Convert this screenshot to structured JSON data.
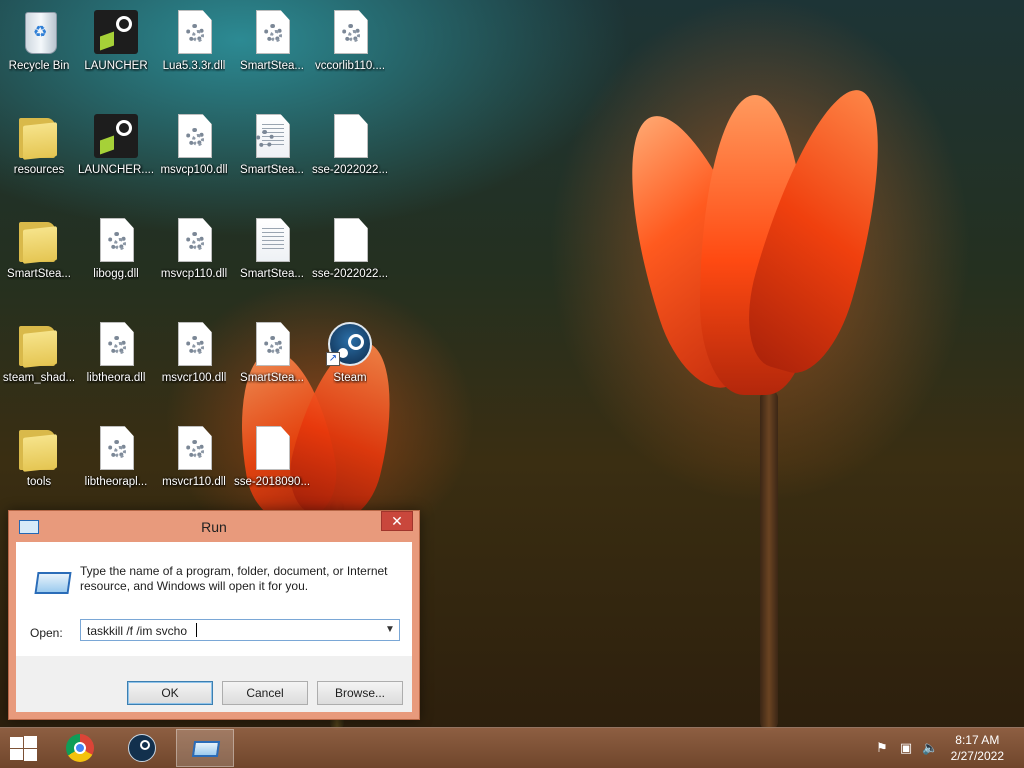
{
  "desktop": {
    "icons": [
      {
        "label": "Recycle Bin",
        "icon": "recycle-bin-icon"
      },
      {
        "label": "LAUNCHER",
        "icon": "launcher-app-icon"
      },
      {
        "label": "Lua5.3.3r.dll",
        "icon": "dll-file-icon"
      },
      {
        "label": "SmartStea...",
        "icon": "dll-file-icon"
      },
      {
        "label": "vccorlib110....",
        "icon": "dll-file-icon"
      },
      {
        "label": "resources",
        "icon": "folder-icon"
      },
      {
        "label": "LAUNCHER....",
        "icon": "launcher-app-icon"
      },
      {
        "label": "msvcp100.dll",
        "icon": "dll-file-icon"
      },
      {
        "label": "SmartStea...",
        "icon": "config-file-icon"
      },
      {
        "label": "sse-2022022...",
        "icon": "blank-file-icon"
      },
      {
        "label": "SmartStea...",
        "icon": "folder-icon"
      },
      {
        "label": "libogg.dll",
        "icon": "dll-file-icon"
      },
      {
        "label": "msvcp110.dll",
        "icon": "dll-file-icon"
      },
      {
        "label": "SmartStea...",
        "icon": "text-file-icon"
      },
      {
        "label": "sse-2022022...",
        "icon": "blank-file-icon"
      },
      {
        "label": "steam_shad...",
        "icon": "folder-icon"
      },
      {
        "label": "libtheora.dll",
        "icon": "dll-file-icon"
      },
      {
        "label": "msvcr100.dll",
        "icon": "dll-file-icon"
      },
      {
        "label": "SmartStea...",
        "icon": "dll-file-icon"
      },
      {
        "label": "Steam",
        "icon": "steam-shortcut-icon"
      },
      {
        "label": "tools",
        "icon": "folder-icon"
      },
      {
        "label": "libtheorapl...",
        "icon": "dll-file-icon"
      },
      {
        "label": "msvcr110.dll",
        "icon": "dll-file-icon"
      },
      {
        "label": "sse-2018090...",
        "icon": "blank-file-icon"
      }
    ]
  },
  "run_dialog": {
    "title": "Run",
    "close_label": "✕",
    "message": "Type the name of a program, folder, document, or Internet resource, and Windows will open it for you.",
    "open_label": "Open:",
    "open_value": "taskkill /f /im svcho",
    "ok_label": "OK",
    "cancel_label": "Cancel",
    "browse_label": "Browse..."
  },
  "taskbar": {
    "pinned": [
      {
        "name": "chrome-icon",
        "active": false
      },
      {
        "name": "steam-icon",
        "active": false
      },
      {
        "name": "run-icon",
        "active": true
      }
    ],
    "tray": {
      "time": "8:17 AM",
      "date": "2/27/2022"
    }
  },
  "colors": {
    "taskbar": "#8a5a3c",
    "dialog_frame": "#e89a7c",
    "close_button": "#c9473c"
  }
}
